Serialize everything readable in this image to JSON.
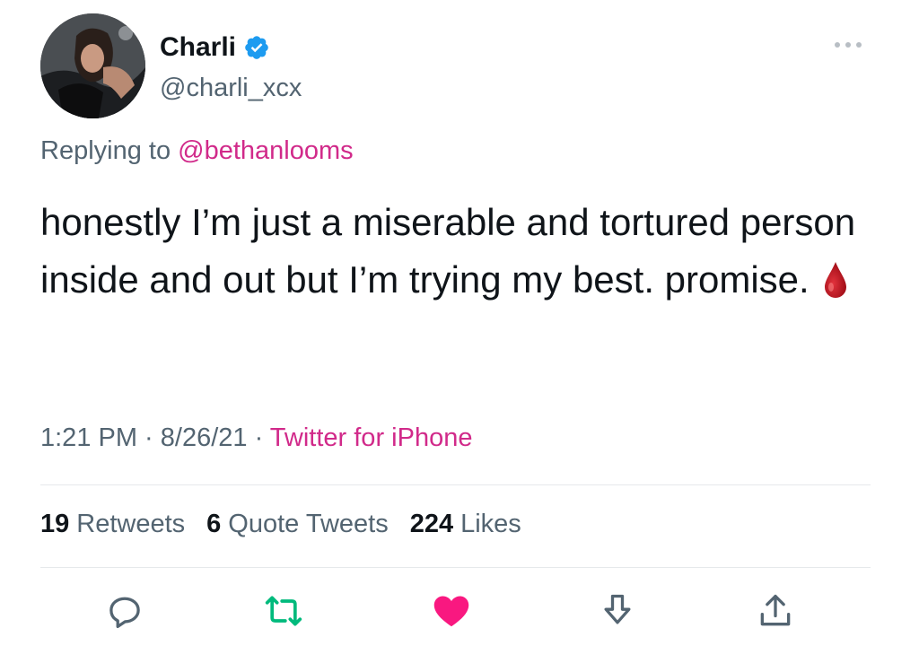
{
  "author": {
    "display_name": "Charli",
    "handle": "@charli_xcx",
    "verified_icon": "verified-badge-icon"
  },
  "reply": {
    "prefix": "Replying to ",
    "mention": "@bethanlooms"
  },
  "tweet": {
    "text": "honestly I’m just a miserable and tortured person inside and out but I’m trying my best. promise.",
    "emoji_icon": "drop-of-blood-icon"
  },
  "meta": {
    "time": "1:21 PM",
    "sep1": " · ",
    "date": "8/26/21",
    "sep2": " · ",
    "source": "Twitter for iPhone"
  },
  "stats": {
    "retweets_count": "19",
    "retweets_label": "Retweets",
    "quotes_count": "6",
    "quotes_label": "Quote Tweets",
    "likes_count": "224",
    "likes_label": "Likes"
  },
  "actions": [
    "reply-icon",
    "retweet-icon",
    "like-icon",
    "bookmark-icon",
    "share-icon"
  ],
  "colors": {
    "accent_pink": "#d12a8a",
    "retweet_green": "#00ba7c",
    "like_pink": "#f91880",
    "verified_blue": "#1d9bf0",
    "muted_text": "#536471"
  }
}
